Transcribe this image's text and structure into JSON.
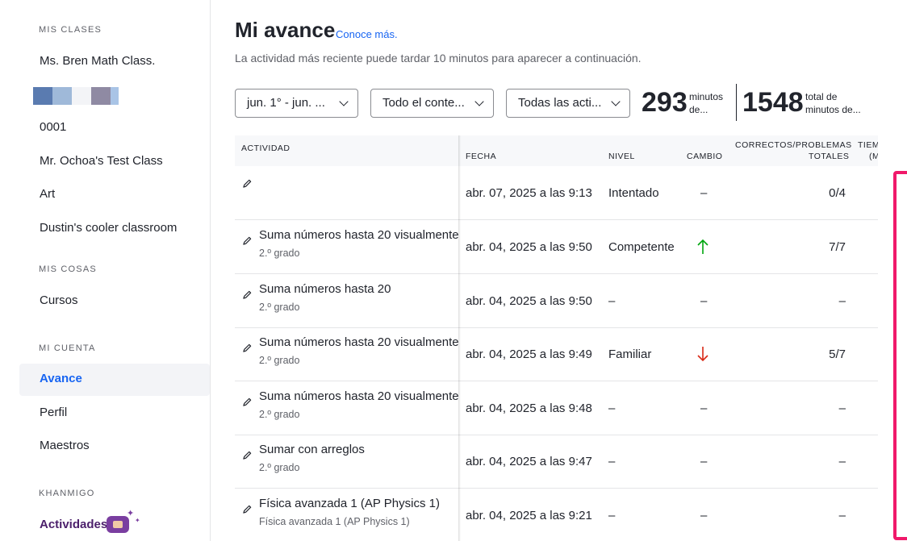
{
  "sidebar": {
    "sections": {
      "classes": "MIS CLASES",
      "stuff": "MIS COSAS",
      "account": "MI CUENTA",
      "khanmigo": "KHANMIGO"
    },
    "classes": [
      "Ms. Bren Math Class.",
      "0001",
      "Mr. Ochoa's Test Class",
      "Art",
      "Dustin's cooler classroom"
    ],
    "stuff": [
      "Cursos"
    ],
    "account": [
      "Avance",
      "Perfil",
      "Maestros"
    ],
    "khanmigo_item": "Actividades",
    "active_item": "Avance"
  },
  "header": {
    "title": "Mi avance",
    "learn_more": "Conoce más.",
    "subtitle": "La actividad más reciente puede tardar 10 minutos para aparecer a continuación."
  },
  "filters": {
    "date_range": "jun. 1° - jun. ...",
    "content": "Todo el conte...",
    "activities": "Todas las acti..."
  },
  "stats": {
    "minutes": "293",
    "minutes_label_1": "minutos",
    "minutes_label_2": "de...",
    "total": "1548",
    "total_label_1": "total de",
    "total_label_2": "minutos de..."
  },
  "table": {
    "headers": {
      "activity": "ACTIVIDAD",
      "date": "FECHA",
      "level": "NIVEL",
      "change": "CAMBIO",
      "correct_1": "CORRECTOS/PROBLEMAS",
      "correct_2": "TOTALES",
      "time_1": "TIEM",
      "time_2": "(M"
    },
    "rows": [
      {
        "name": "",
        "grade": "",
        "date": "abr. 07, 2025 a las 9:13",
        "level": "Intentado",
        "change": "–",
        "score": "0/4"
      },
      {
        "name": "Suma números hasta 20 visualmente",
        "grade": "2.º grado",
        "date": "abr. 04, 2025 a las 9:50",
        "level": "Competente",
        "change": "up",
        "score": "7/7"
      },
      {
        "name": "Suma números hasta 20",
        "grade": "2.º grado",
        "date": "abr. 04, 2025 a las 9:50",
        "level": "–",
        "change": "–",
        "score": "–"
      },
      {
        "name": "Suma números hasta 20 visualmente",
        "grade": "2.º grado",
        "date": "abr. 04, 2025 a las 9:49",
        "level": "Familiar",
        "change": "down",
        "score": "5/7"
      },
      {
        "name": "Suma números hasta 20 visualmente",
        "grade": "2.º grado",
        "date": "abr. 04, 2025 a las 9:48",
        "level": "–",
        "change": "–",
        "score": "–"
      },
      {
        "name": "Sumar con arreglos",
        "grade": "2.º grado",
        "date": "abr. 04, 2025 a las 9:47",
        "level": "–",
        "change": "–",
        "score": "–"
      },
      {
        "name": "Física avanzada 1 (AP Physics 1)",
        "grade": "Física avanzada 1 (AP Physics 1)",
        "date": "abr. 04, 2025 a las 9:21",
        "level": "–",
        "change": "–",
        "score": "–"
      }
    ]
  },
  "colors": {
    "accent": "#1865f2",
    "highlight": "#f0196a",
    "up": "#00a60e",
    "down": "#d92916",
    "khanmigo": "#7a3ea0"
  }
}
